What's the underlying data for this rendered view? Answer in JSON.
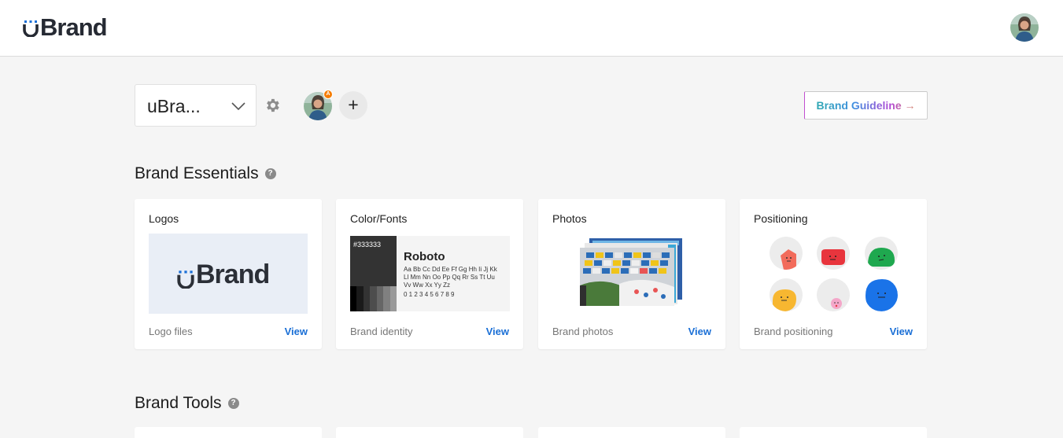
{
  "app": {
    "brand_name": "Brand"
  },
  "workspace": {
    "selected": "uBra...",
    "add_label": "+",
    "admin_badge": "A"
  },
  "header": {
    "guideline_button": "Brand Guideline →"
  },
  "sections": {
    "essentials": {
      "title": "Brand Essentials",
      "help": "?"
    },
    "tools": {
      "title": "Brand Tools",
      "help": "?"
    }
  },
  "cards": [
    {
      "title": "Logos",
      "caption": "Logo files",
      "view": "View",
      "preview_text": "Brand"
    },
    {
      "title": "Color/Fonts",
      "caption": "Brand identity",
      "view": "View",
      "color_hex": "#333333",
      "font_name": "Roboto",
      "font_lines": [
        "Aa Bb Cc Dd Ee Ff Gg Hh Ii Jj Kk",
        "Ll Mm Nn Oo Pp Qq Rr Ss Tt Uu",
        "Vv Ww Xx Yy Zz",
        "0 1 2 3 4 5 6 7 8 9"
      ]
    },
    {
      "title": "Photos",
      "caption": "Brand photos",
      "view": "View"
    },
    {
      "title": "Positioning",
      "caption": "Brand positioning",
      "view": "View"
    }
  ],
  "colors": {
    "accent": "#1a6fd6",
    "swatch": "#333333",
    "positioning_blobs": [
      "#f26b5b",
      "#e8353d",
      "#1fa84f",
      "#f7b731",
      "#f4a7c9",
      "#1a73e8"
    ]
  }
}
